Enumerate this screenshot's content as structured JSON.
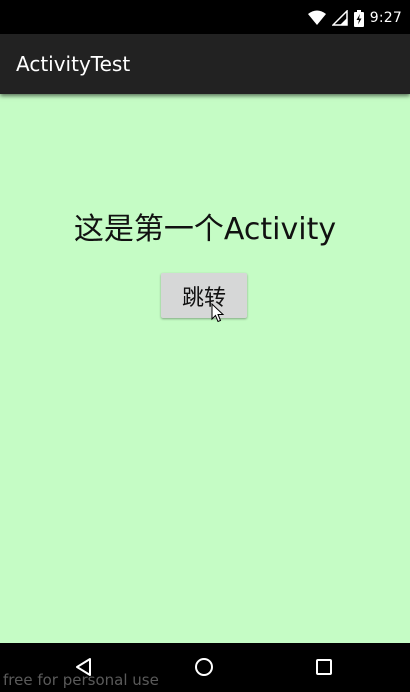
{
  "status_bar": {
    "time": "9:27",
    "icons": [
      "wifi-icon",
      "signal-icon",
      "battery-charging-icon"
    ]
  },
  "app_bar": {
    "title": "ActivityTest",
    "background": "#222222"
  },
  "content": {
    "headline": "这是第一个Activity",
    "jump_button_label": "跳转",
    "background": "#c5fcc5"
  },
  "nav_bar": {
    "icons": [
      "back-icon",
      "home-icon",
      "recents-icon"
    ]
  },
  "watermark": "free for personal use"
}
